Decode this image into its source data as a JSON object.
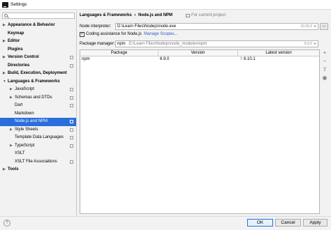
{
  "window": {
    "title": "Settings"
  },
  "sidebar": {
    "items": [
      {
        "label": "Appearance & Behavior",
        "arrow": "▶",
        "indent": 0,
        "bold": true,
        "copy": false,
        "selected": false
      },
      {
        "label": "Keymap",
        "arrow": "",
        "indent": 0,
        "bold": true,
        "copy": false,
        "selected": false
      },
      {
        "label": "Editor",
        "arrow": "▶",
        "indent": 0,
        "bold": true,
        "copy": false,
        "selected": false
      },
      {
        "label": "Plugins",
        "arrow": "",
        "indent": 0,
        "bold": true,
        "copy": false,
        "selected": false
      },
      {
        "label": "Version Control",
        "arrow": "▶",
        "indent": 0,
        "bold": true,
        "copy": true,
        "selected": false
      },
      {
        "label": "Directories",
        "arrow": "",
        "indent": 0,
        "bold": true,
        "copy": true,
        "selected": false
      },
      {
        "label": "Build, Execution, Deployment",
        "arrow": "▶",
        "indent": 0,
        "bold": true,
        "copy": false,
        "selected": false
      },
      {
        "label": "Languages & Frameworks",
        "arrow": "▼",
        "indent": 0,
        "bold": true,
        "copy": false,
        "selected": false
      },
      {
        "label": "JavaScript",
        "arrow": "▶",
        "indent": 1,
        "bold": false,
        "copy": true,
        "selected": false
      },
      {
        "label": "Schemas and DTDs",
        "arrow": "▶",
        "indent": 1,
        "bold": false,
        "copy": true,
        "selected": false
      },
      {
        "label": "Dart",
        "arrow": "",
        "indent": 1,
        "bold": false,
        "copy": true,
        "selected": false
      },
      {
        "label": "Markdown",
        "arrow": "",
        "indent": 1,
        "bold": false,
        "copy": false,
        "selected": false
      },
      {
        "label": "Node.js and NPM",
        "arrow": "",
        "indent": 1,
        "bold": false,
        "copy": true,
        "selected": true
      },
      {
        "label": "Style Sheets",
        "arrow": "▶",
        "indent": 1,
        "bold": false,
        "copy": true,
        "selected": false
      },
      {
        "label": "Template Data Languages",
        "arrow": "",
        "indent": 1,
        "bold": false,
        "copy": true,
        "selected": false
      },
      {
        "label": "TypeScript",
        "arrow": "▶",
        "indent": 1,
        "bold": false,
        "copy": true,
        "selected": false
      },
      {
        "label": "XSLT",
        "arrow": "",
        "indent": 1,
        "bold": false,
        "copy": false,
        "selected": false
      },
      {
        "label": "XSLT File Associations",
        "arrow": "",
        "indent": 1,
        "bold": false,
        "copy": true,
        "selected": false
      },
      {
        "label": "Tools",
        "arrow": "▶",
        "indent": 0,
        "bold": true,
        "copy": false,
        "selected": false
      }
    ]
  },
  "header": {
    "crumb_parent": "Languages & Frameworks",
    "crumb_sep": "›",
    "crumb_current": "Node.js and NPM",
    "scope_note": "For current project"
  },
  "interpreter": {
    "label": "Node interpreter:",
    "value": "D:\\Learn Files\\Nodejs\\node.exe",
    "version": "10.16.0",
    "browse": "..."
  },
  "coding": {
    "checked": "✓",
    "label": "Coding assistance for Node.js",
    "link": "Manage Scopes..."
  },
  "package_manager": {
    "label": "Package manager:",
    "name": "npm",
    "path": "D:\\Learn Files\\Nodejs\\node_modules\\npm",
    "version": "6.9.0"
  },
  "packages": {
    "columns": [
      "Package",
      "Version",
      "Latest version"
    ],
    "rows": [
      {
        "package": "npm",
        "version": "6.9.0",
        "latest": "6.10.1",
        "upgrade": "⇧"
      }
    ]
  },
  "tools": {
    "add": "+",
    "remove": "−",
    "upgrade": "⇧",
    "view": "◉"
  },
  "footer": {
    "help": "?",
    "ok": "OK",
    "cancel": "Cancel",
    "apply": "Apply"
  }
}
